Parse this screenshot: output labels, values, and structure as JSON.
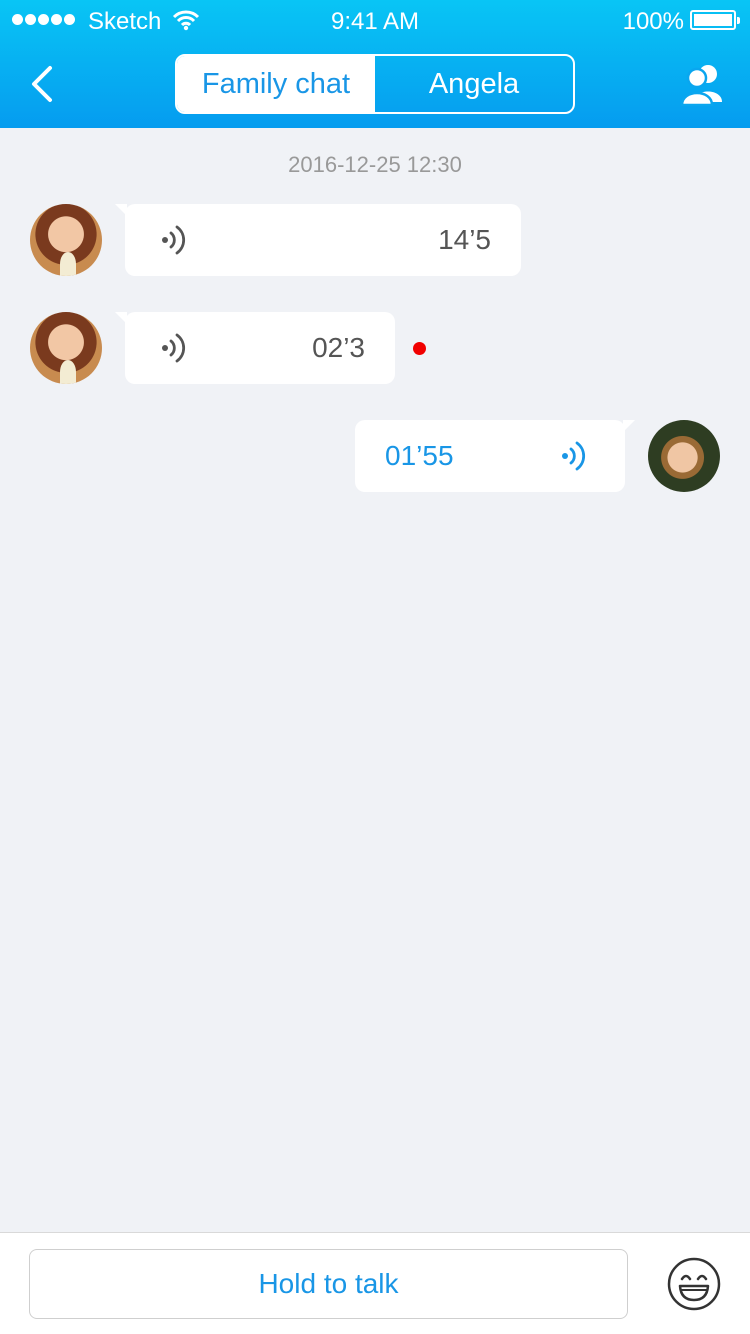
{
  "status_bar": {
    "carrier": "Sketch",
    "time": "9:41 AM",
    "battery": "100%"
  },
  "header": {
    "tabs": [
      {
        "label": "Family chat",
        "active": true
      },
      {
        "label": "Angela",
        "active": false
      }
    ],
    "back_icon": "chevron-left-icon",
    "contacts_icon": "contacts-icon"
  },
  "chat": {
    "timestamp": "2016-12-25 12:30",
    "messages": [
      {
        "side": "left",
        "duration": "14’5",
        "unread": false
      },
      {
        "side": "left",
        "duration": "02’3",
        "unread": true
      },
      {
        "side": "right",
        "duration": "01’55",
        "unread": false
      }
    ]
  },
  "footer": {
    "talk_label": "Hold to talk",
    "emoji_icon": "smiley-face-icon"
  },
  "colors": {
    "accent": "#1996e6",
    "header_top": "#09c5f5",
    "header_bottom": "#059cef",
    "unread": "#f10000",
    "background": "#f0f2f6"
  }
}
